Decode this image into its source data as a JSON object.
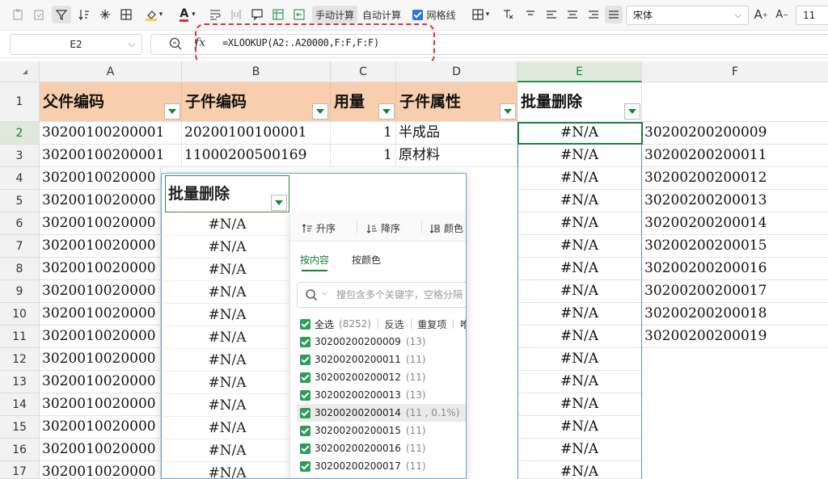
{
  "toolbar": {
    "manual_calc": "手动计算",
    "auto_calc": "自动计算",
    "gridlines": "网格线",
    "font_name": "宋体",
    "font_size": "11"
  },
  "formula_bar": {
    "cell_ref": "E2",
    "fx": "fx",
    "formula": "=XLOOKUP(A2:.A20000,F:F,F:F)"
  },
  "columns": [
    "A",
    "B",
    "C",
    "D",
    "E",
    "F"
  ],
  "rows": [
    "1",
    "2",
    "3",
    "4",
    "5",
    "6",
    "7",
    "8",
    "9",
    "10",
    "11",
    "12",
    "13",
    "14",
    "15",
    "16",
    "17"
  ],
  "header_row": {
    "A": "父件编码",
    "B": "子件编码",
    "C": "用量",
    "D": "子件属性",
    "E": "批量删除"
  },
  "visible_rows": [
    {
      "A": "30200100200001",
      "B": "20200100100001",
      "C": "1",
      "D": "半成品",
      "E": "#N/A",
      "F": "30200200200009"
    },
    {
      "A": "30200100200001",
      "B": "11000200500169",
      "C": "1",
      "D": "原材料",
      "E": "#N/A",
      "F": "30200200200011"
    }
  ],
  "col_a_partial": [
    "3020010020000",
    "3020010020000",
    "3020010020000",
    "3020010020000",
    "3020010020000",
    "3020010020000",
    "3020010020000",
    "3020010020000",
    "3020010020000",
    "3020010020000",
    "3020010020000",
    "3020010020000",
    "3020010020000",
    "3020010020000"
  ],
  "col_e_rest": [
    "#N/A",
    "#N/A",
    "#N/A",
    "#N/A",
    "#N/A",
    "#N/A",
    "#N/A",
    "#N/A",
    "#N/A",
    "#N/A",
    "#N/A",
    "#N/A",
    "#N/A",
    "#N/A"
  ],
  "col_f_rest": [
    "30200200200012",
    "30200200200013",
    "30200200200014",
    "30200200200015",
    "30200200200016",
    "30200200200017",
    "30200200200018",
    "30200200200019"
  ],
  "overlay": {
    "header": "批量删除",
    "cells": [
      "#N/A",
      "#N/A",
      "#N/A",
      "#N/A",
      "#N/A",
      "#N/A",
      "#N/A",
      "#N/A",
      "#N/A",
      "#N/A",
      "#N/A",
      "#N/A"
    ]
  },
  "filter_panel": {
    "sort_asc": "升序",
    "sort_desc": "降序",
    "sort_color": "颜色",
    "tab_content": "按内容",
    "tab_color": "按颜色",
    "search_placeholder": "搜包含多个关键字，空格分隔",
    "select_all": "全选",
    "select_all_count": "(8252)",
    "invert": "反选",
    "duplicates": "重复项",
    "unique_partial": "唯",
    "items": [
      {
        "label": "30200200200009",
        "count": "(13)"
      },
      {
        "label": "30200200200011",
        "count": "(11)"
      },
      {
        "label": "30200200200012",
        "count": "(11)"
      },
      {
        "label": "30200200200013",
        "count": "(13)"
      },
      {
        "label": "30200200200014",
        "count": "(11 , 0.1%)"
      },
      {
        "label": "30200200200015",
        "count": "(11)"
      },
      {
        "label": "30200200200016",
        "count": "(11)"
      },
      {
        "label": "30200200200017",
        "count": "(11)"
      }
    ]
  }
}
